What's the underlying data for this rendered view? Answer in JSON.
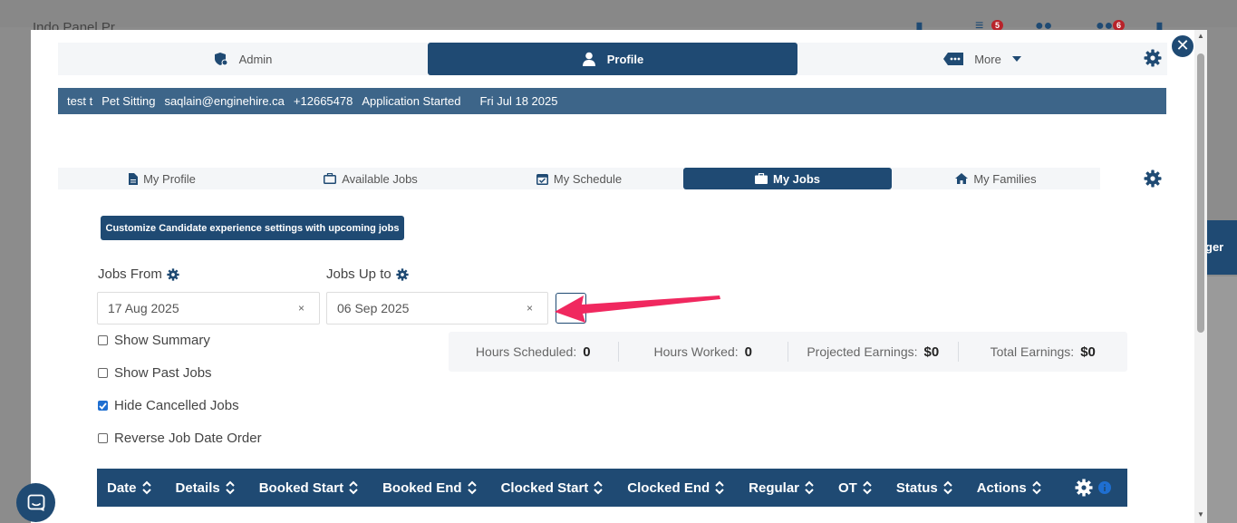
{
  "background": {
    "logo_text": "Indo Panel Pr",
    "badge_1": "5",
    "badge_2": "6",
    "right_text": "ger"
  },
  "topnav": [
    {
      "label": "Admin",
      "icon": "user-shield-icon",
      "active": false
    },
    {
      "label": "Profile",
      "icon": "user-icon",
      "active": true
    },
    {
      "label": "More",
      "icon": "ellipsis-tag-icon",
      "active": false
    }
  ],
  "infobar": {
    "name": "test t",
    "service": "Pet Sitting",
    "email": "saqlain@enginehire.ca",
    "phone": "+12665478",
    "status": "Application Started",
    "date": "Fri Jul 18 2025"
  },
  "subnav": [
    {
      "label": "My Profile",
      "icon": "file-icon",
      "active": false
    },
    {
      "label": "Available Jobs",
      "icon": "briefcase-outline-icon",
      "active": false
    },
    {
      "label": "My Schedule",
      "icon": "calendar-check-icon",
      "active": false
    },
    {
      "label": "My Jobs",
      "icon": "briefcase-icon",
      "active": true
    },
    {
      "label": "My Families",
      "icon": "home-icon",
      "active": false
    }
  ],
  "customize_button": "Customize Candidate experience settings with upcoming jobs",
  "filters": {
    "jobs_from_label": "Jobs From",
    "jobs_from_value": "17 Aug 2025",
    "jobs_to_label": "Jobs Up to",
    "jobs_to_value": "06 Sep 2025",
    "clear_symbol": "×"
  },
  "checkboxes": [
    {
      "label": "Show Summary",
      "checked": false
    },
    {
      "label": "Show Past Jobs",
      "checked": false
    },
    {
      "label": "Hide Cancelled Jobs",
      "checked": true
    },
    {
      "label": "Reverse Job Date Order",
      "checked": false
    }
  ],
  "summary": [
    {
      "label": "Hours Scheduled:",
      "value": "0"
    },
    {
      "label": "Hours Worked:",
      "value": "0"
    },
    {
      "label": "Projected Earnings:",
      "value": "$0"
    },
    {
      "label": "Total Earnings:",
      "value": "$0"
    }
  ],
  "table_headers": [
    "Date",
    "Details",
    "Booked Start",
    "Booked End",
    "Clocked Start",
    "Clocked End",
    "Regular",
    "OT",
    "Status",
    "Actions"
  ],
  "colors": {
    "primary": "#1f4a73",
    "infobar": "#3d6589",
    "arrow": "#f0285f",
    "checkbox": "#1f6fd1"
  }
}
